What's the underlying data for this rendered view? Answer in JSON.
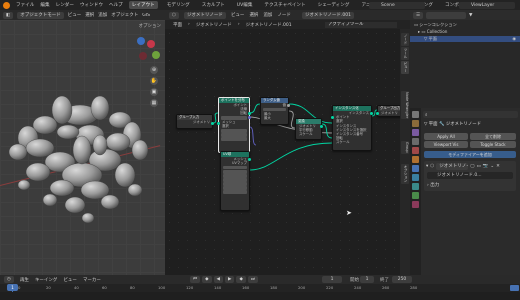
{
  "topbar": {
    "menus": [
      "ファイル",
      "編集",
      "レンダー",
      "ウィンドウ",
      "ヘルプ"
    ],
    "workspaces": [
      "レイアウト",
      "モデリング",
      "スカルプト",
      "UV編集",
      "テクスチャペイント",
      "シェーディング",
      "アニメーション",
      "レンダリング",
      "コンポジティング"
    ],
    "active_workspace": "レイアウト",
    "scene": "Scene",
    "view_layer": "ViewLayer"
  },
  "viewport": {
    "header": [
      "オブジェクトモード",
      "ビュー",
      "選択",
      "追加",
      "オブジェクト",
      "GIS"
    ],
    "options_label": "オプション"
  },
  "node_editor": {
    "header": [
      "ジオメトリノード",
      "ビュー",
      "選択",
      "追加",
      "ノード"
    ],
    "node_group": "ジオメトリノード.001",
    "breadcrumbs": [
      "平面",
      "ジオメトリノード",
      "ジオメトリノード.001"
    ],
    "active_tool": "アクティブツール",
    "nodes": [
      {
        "title": "グループ入力",
        "rows": [
          "ジオメトリ"
        ]
      },
      {
        "title": "ポイントを分布",
        "rows": [
          "ポイント",
          "法線",
          "回転",
          "メッシュ",
          "選択",
          "距離(最小)",
          "最大密度",
          "密度係数",
          "シード"
        ]
      },
      {
        "title": "ランダム値",
        "rows": [
          "値",
          "最小",
          "最大",
          "ID",
          "シード"
        ]
      },
      {
        "title": "変換",
        "rows": [
          "ジオメトリ",
          "平行移動",
          "回転",
          "スケール"
        ]
      },
      {
        "title": "インスタンス化",
        "rows": [
          "インスタンス",
          "ポイント",
          "選択",
          "インスタンス",
          "インスタンスを選択",
          "インスタンス番号",
          "回転",
          "スケール"
        ]
      },
      {
        "title": "グループ出力",
        "rows": [
          "ジオメトリ"
        ]
      },
      {
        "title": "UV球",
        "rows": [
          "メッシュ",
          "UVマップ",
          "セグメント",
          "リング",
          "半径"
        ]
      }
    ],
    "side_tabs": [
      "ノード",
      "ツール",
      "ビュー",
      "Node Wrangler",
      "Group",
      "オプション"
    ]
  },
  "outliner": {
    "title": "シーンコレクション",
    "rows": [
      "シーンコレクション",
      "Collection",
      "平面"
    ]
  },
  "properties": {
    "object": "平面",
    "modifier_name": "ジオメトリノード",
    "buttons": {
      "apply_all": "Apply All",
      "delete_all": "全て削除",
      "viewport_vis": "Viewport Vis",
      "toggle_stack": "Toggle Stack",
      "add_modifier": "モディファイアーを追加"
    },
    "node_group": "ジオメトリノード.0...",
    "output_attribute": "出力"
  },
  "timeline": {
    "header": [
      "再生",
      "キーイング",
      "ビュー",
      "マーカー"
    ],
    "current_frame": "1",
    "start_label": "開始",
    "start": "1",
    "end_label": "終了",
    "end": "250",
    "ticks": [
      "0",
      "20",
      "40",
      "60",
      "80",
      "100",
      "120",
      "140",
      "160",
      "180",
      "200",
      "220",
      "240",
      "260",
      "280"
    ]
  },
  "colors": {
    "accent": "#4772b3",
    "node_header_green": "#1d725e",
    "node_header_blue": "#3e5e86",
    "geometry_socket": "#00d6a3",
    "float_socket": "#a1a1a1",
    "vector_socket": "#6363c7",
    "blender_orange": "#e87d0d"
  }
}
